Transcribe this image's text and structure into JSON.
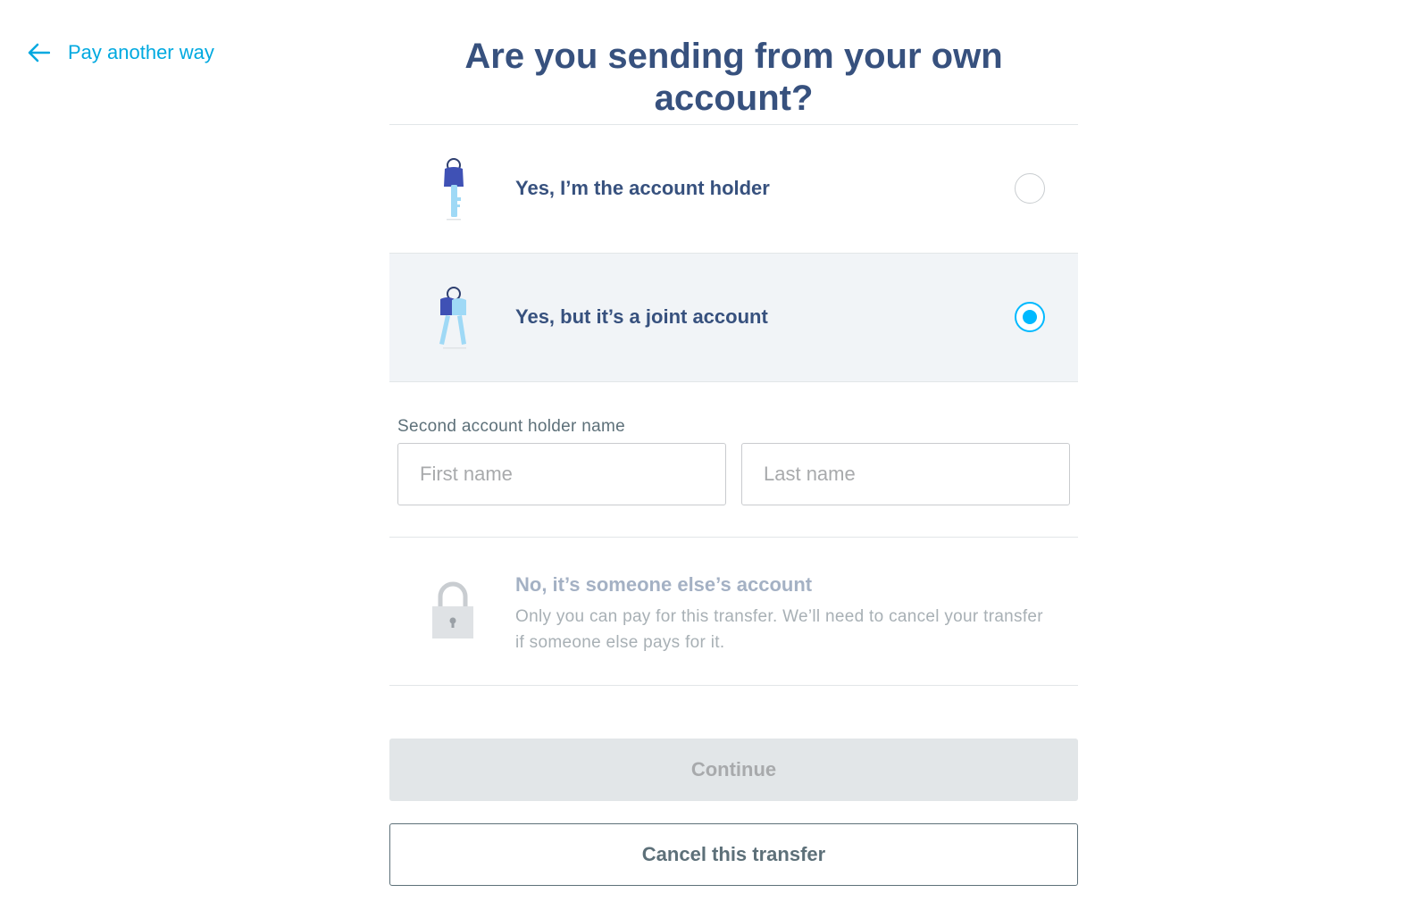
{
  "nav": {
    "back_label": "Pay another way"
  },
  "header": {
    "title": "Are you sending from your own account?"
  },
  "options": [
    {
      "label": "Yes, I’m the account holder",
      "icon": "single-key-icon",
      "selected": false
    },
    {
      "label": "Yes, but it’s a joint account",
      "icon": "two-keys-icon",
      "selected": true
    }
  ],
  "joint": {
    "label": "Second account holder name",
    "first_name_placeholder": "First name",
    "last_name_placeholder": "Last name"
  },
  "disabled_option": {
    "title": "No, it’s someone else’s account",
    "description": "Only you can pay for this transfer. We’ll need to cancel your transfer if someone else pays for it.",
    "icon": "padlock-icon"
  },
  "buttons": {
    "continue_label": "Continue",
    "cancel_label": "Cancel this transfer"
  },
  "colors": {
    "accent": "#00b9ff",
    "heading": "#37517e",
    "link": "#00a9e0"
  }
}
